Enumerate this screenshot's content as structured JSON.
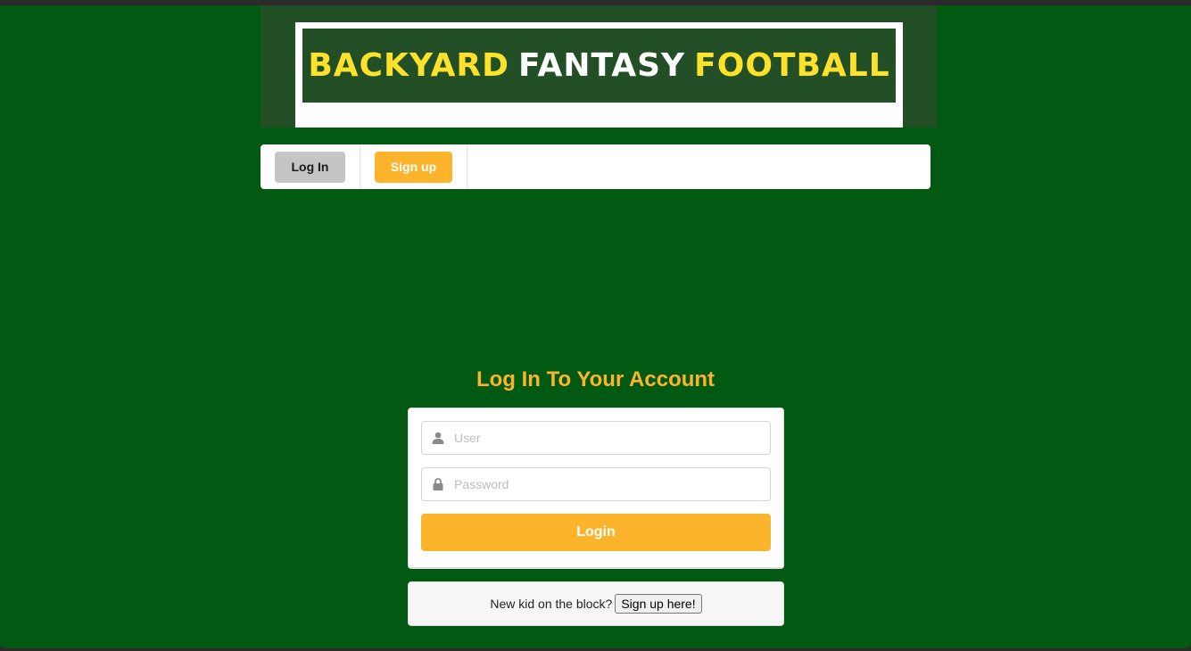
{
  "banner": {
    "word1": "BACKYARD",
    "word2": "FANTASY",
    "word3": "FOOTBALL"
  },
  "nav": {
    "login_label": "Log In",
    "signup_label": "Sign up"
  },
  "form": {
    "title": "Log In To Your Account",
    "user_placeholder": "User",
    "password_placeholder": "Password",
    "submit_label": "Login"
  },
  "signup_message": {
    "text": "New kid on the block?",
    "button_label": "Sign up here!"
  },
  "colors": {
    "page_bg": "#025912",
    "banner_bg": "#234f27",
    "accent_yellow": "#fcb42c",
    "logo_yellow": "#fde12a"
  }
}
